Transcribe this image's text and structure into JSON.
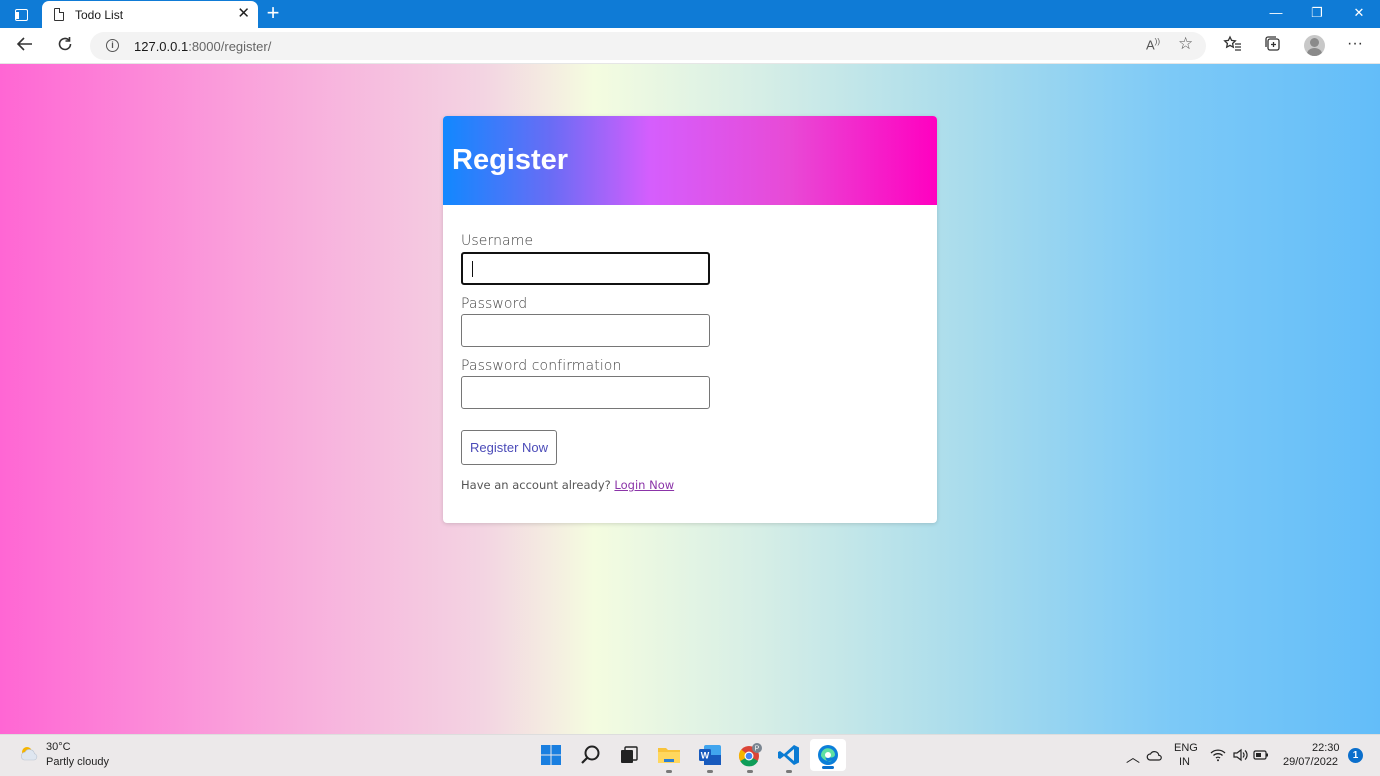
{
  "browser": {
    "tab_title": "Todo List",
    "tab_close": "✕",
    "new_tab": "+",
    "url_host": "127.0.0.1",
    "url_path": ":8000/register/",
    "window_minimize": "—",
    "window_restore": "❐",
    "window_close": "✕"
  },
  "card": {
    "title": "Register",
    "username_label": "Username",
    "username_value": "",
    "password_label": "Password",
    "password_value": "",
    "password_confirm_label": "Password confirmation",
    "password_confirm_value": "",
    "submit_label": "Register Now",
    "helper_text": "Have an account already?",
    "login_link": "Login Now"
  },
  "taskbar": {
    "weather_temp": "30°C",
    "weather_desc": "Partly cloudy",
    "lang_top": "ENG",
    "lang_bottom": "IN",
    "time": "22:30",
    "date": "29/07/2022",
    "notification_count": "1",
    "apps": [
      "start-icon",
      "search-icon",
      "task-view-icon",
      "file-explorer-icon",
      "word-icon",
      "chrome-icon",
      "vscode-icon",
      "edge-icon"
    ]
  },
  "colors": {
    "titlebar": "#0f7bd6",
    "header_gradient_start": "#1188ff",
    "header_gradient_end": "#ff00c0",
    "link": "#8b34a8",
    "accent": "#0b6fcc"
  }
}
